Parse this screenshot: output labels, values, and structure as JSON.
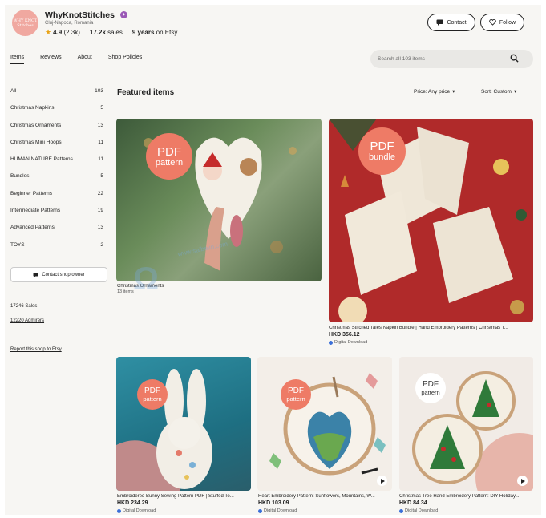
{
  "shop": {
    "name": "WhyKnotStitches",
    "logo_text": "WHY KNOT Stitches",
    "location": "Cluj-Napoca, Romania",
    "rating": "4.9",
    "rating_count": "(2.3k)",
    "sales_count": "17.2k",
    "sales_label": "sales",
    "years": "9 years",
    "years_suffix": "on Etsy"
  },
  "header": {
    "contact_label": "Contact",
    "follow_label": "Follow"
  },
  "tabs": [
    {
      "label": "Items"
    },
    {
      "label": "Reviews"
    },
    {
      "label": "About"
    },
    {
      "label": "Shop Policies"
    }
  ],
  "search": {
    "placeholder": "Search all 103 items"
  },
  "categories": [
    {
      "label": "All",
      "count": "103"
    },
    {
      "label": "Christmas Napkins",
      "count": "5"
    },
    {
      "label": "Christmas Ornaments",
      "count": "13"
    },
    {
      "label": "Christmas Mini Hoops",
      "count": "11"
    },
    {
      "label": "HUMAN NATURE Patterns",
      "count": "11"
    },
    {
      "label": "Bundles",
      "count": "5"
    },
    {
      "label": "Beginner Patterns",
      "count": "22"
    },
    {
      "label": "Intermediate Patterns",
      "count": "19"
    },
    {
      "label": "Advanced Patterns",
      "count": "13"
    },
    {
      "label": "TOYS",
      "count": "2"
    }
  ],
  "sidebar": {
    "contact_owner": "Contact shop owner",
    "sales": "17246 Sales",
    "admirers": "12220 Admirers",
    "report": "Report this shop to Etsy"
  },
  "featured": {
    "title": "Featured items",
    "price_filter": "Price: Any price",
    "sort": "Sort: Custom"
  },
  "items": [
    {
      "title": "Christmas Ornaments",
      "sub": "13 items",
      "badge_top": "PDF",
      "badge_bottom": "pattern"
    },
    {
      "title": "Christmas Stitched Tales Napkin Bundle | Hand Embroidery Patterns | Christmas T...",
      "price": "HKD 356.12",
      "digital": "Digital Download",
      "badge_top": "PDF",
      "badge_bottom": "bundle"
    },
    {
      "title": "Embroidered Bunny Sewing Pattern PDF | Stuffed To...",
      "price": "HKD 234.29",
      "digital": "Digital Download",
      "badge_top": "PDF",
      "badge_bottom": "pattern"
    },
    {
      "title": "Heart Embroidery Pattern: Sunflowers, Mountains, W...",
      "price": "HKD 103.09",
      "digital": "Digital Download",
      "badge_top": "PDF",
      "badge_bottom": "pattern"
    },
    {
      "title": "Christmas Tree Hand Embroidery Pattern: DIY Holiday...",
      "price": "HKD 84.34",
      "digital": "Digital Download",
      "badge_top": "PDF",
      "badge_bottom": "pattern"
    }
  ],
  "watermark": {
    "text": "www.saibeiip.com"
  },
  "colors": {
    "accent_badge": "#ee7b66",
    "star": "#e8a317",
    "verified": "#9b59b6",
    "napkin_bg": "#b02a2a"
  }
}
